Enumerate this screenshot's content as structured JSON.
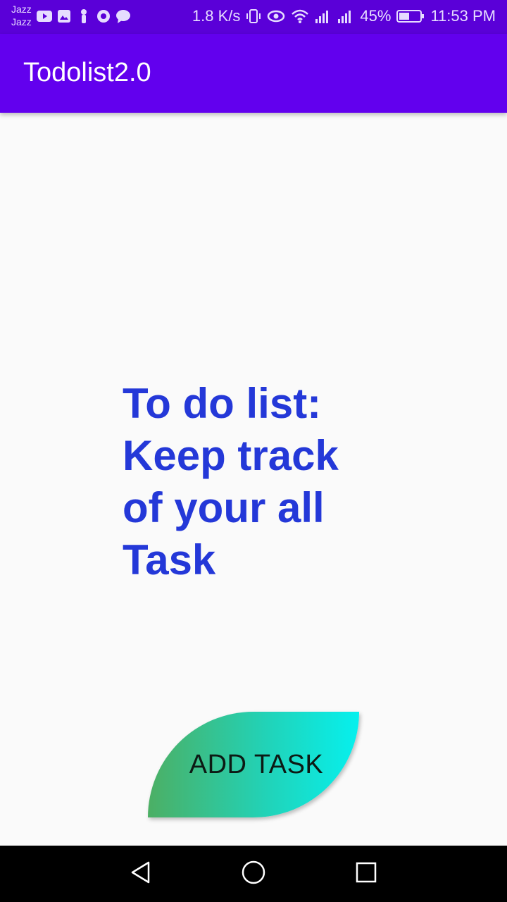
{
  "status_bar": {
    "carrier_line1": "Jazz",
    "carrier_line2": "Jazz",
    "network_speed": "1.8 K/s",
    "battery": "45%",
    "time": "11:53 PM",
    "icons": [
      "youtube-icon",
      "photo-icon",
      "figure-icon",
      "settings-icon",
      "chat-icon",
      "vibrate-icon",
      "eye-icon",
      "wifi-icon",
      "signal-icon",
      "signal-icon",
      "battery-icon"
    ]
  },
  "app_bar": {
    "title": "Todolist2.0"
  },
  "main": {
    "headline_lines": [
      "To do list:",
      "Keep track",
      "of your all",
      "Task"
    ]
  },
  "add_task": {
    "label": "ADD TASK"
  },
  "nav_bar": {
    "icons": [
      "back-icon",
      "home-icon",
      "recents-icon"
    ]
  },
  "colors": {
    "status_bar": "#5a00d8",
    "app_bar": "#6200ee",
    "headline": "#2438d8",
    "button_gradient_start": "#4caf64",
    "button_gradient_end": "#06f0ee",
    "background": "#fafafa"
  }
}
